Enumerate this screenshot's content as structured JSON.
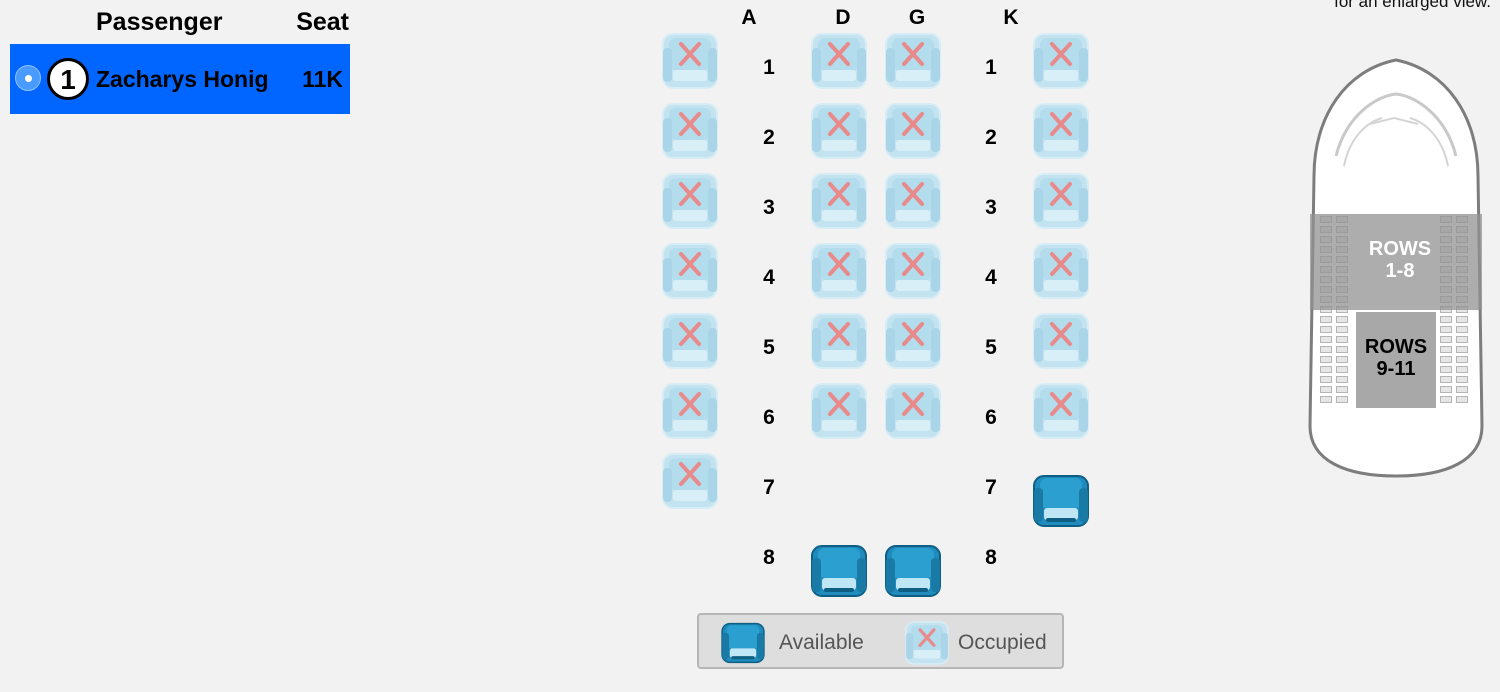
{
  "passenger_panel": {
    "header_passenger": "Passenger",
    "header_seat": "Seat",
    "passengers": [
      {
        "number": "1",
        "name": "Zacharys Honig",
        "seat": "11K"
      }
    ]
  },
  "seat_map": {
    "columns": [
      "A",
      "D",
      "G",
      "K"
    ],
    "rows": [
      {
        "number": "1",
        "seats": {
          "A": "occupied",
          "D": "occupied",
          "G": "occupied",
          "K": "occupied"
        }
      },
      {
        "number": "2",
        "seats": {
          "A": "occupied",
          "D": "occupied",
          "G": "occupied",
          "K": "occupied"
        }
      },
      {
        "number": "3",
        "seats": {
          "A": "occupied",
          "D": "occupied",
          "G": "occupied",
          "K": "occupied"
        }
      },
      {
        "number": "4",
        "seats": {
          "A": "occupied",
          "D": "occupied",
          "G": "occupied",
          "K": "occupied"
        }
      },
      {
        "number": "5",
        "seats": {
          "A": "occupied",
          "D": "occupied",
          "G": "occupied",
          "K": "occupied"
        }
      },
      {
        "number": "6",
        "seats": {
          "A": "occupied",
          "D": "occupied",
          "G": "occupied",
          "K": "occupied"
        }
      },
      {
        "number": "7",
        "seats": {
          "A": "occupied",
          "K": "available"
        }
      },
      {
        "number": "8",
        "seats": {
          "D": "available",
          "G": "available"
        }
      }
    ]
  },
  "legend": {
    "available_label": "Available",
    "occupied_label": "Occupied"
  },
  "minimap": {
    "hint_text": "for an enlarged view.",
    "sections": [
      {
        "label_line1": "ROWS",
        "label_line2": "1-8",
        "active": true
      },
      {
        "label_line1": "ROWS",
        "label_line2": "9-11",
        "active": false
      }
    ]
  },
  "colors": {
    "selected_row": "#0066ff",
    "available_seat": "#2a9fd0",
    "occupied_seat": "#c4e3f0",
    "occupied_mark": "#e88a8a"
  }
}
